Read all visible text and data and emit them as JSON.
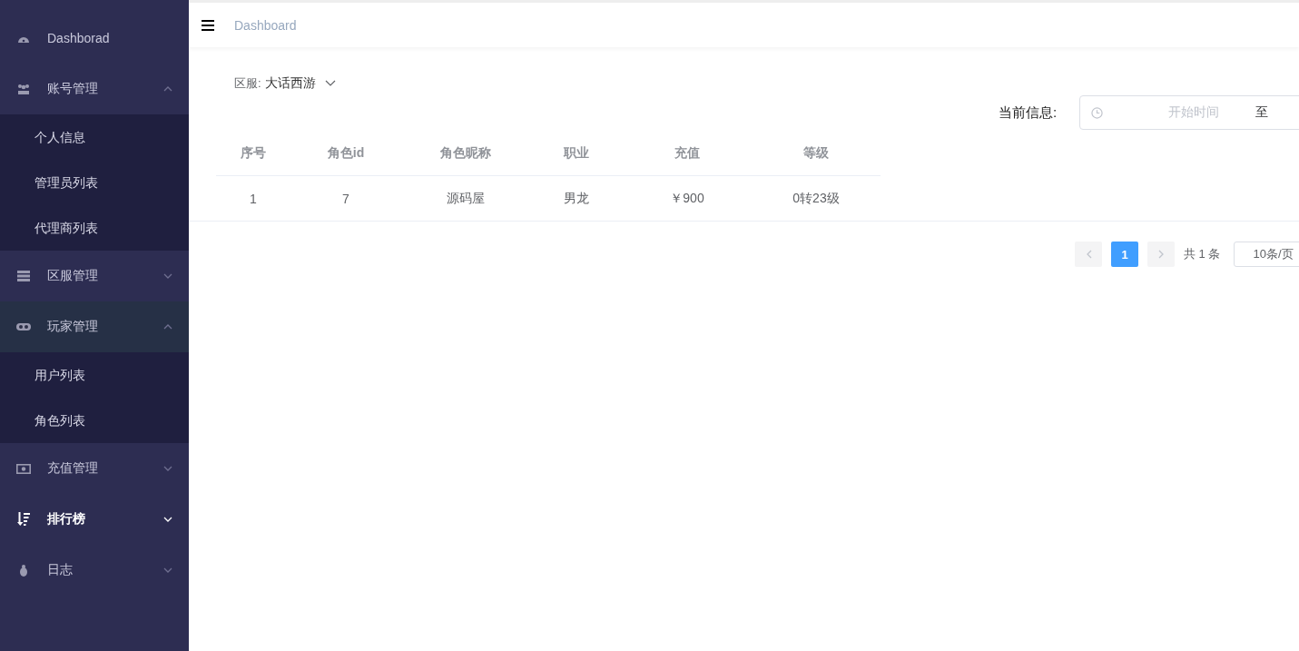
{
  "sidebar": {
    "items": [
      {
        "kind": "link",
        "label": "Dashborad",
        "selected": false
      },
      {
        "kind": "group",
        "label": "账号管理",
        "expanded": true,
        "selected": false,
        "children": [
          {
            "label": "个人信息"
          },
          {
            "label": "管理员列表"
          },
          {
            "label": "代理商列表"
          }
        ]
      },
      {
        "kind": "group",
        "label": "区服管理",
        "expanded": false,
        "selected": false
      },
      {
        "kind": "group",
        "label": "玩家管理",
        "expanded": true,
        "selected": true,
        "children": [
          {
            "label": "用户列表"
          },
          {
            "label": "角色列表"
          }
        ]
      },
      {
        "kind": "group",
        "label": "充值管理",
        "expanded": false,
        "selected": false
      },
      {
        "kind": "group",
        "label": "排行榜",
        "expanded": false,
        "selected": false,
        "hovered": true
      },
      {
        "kind": "group",
        "label": "日志",
        "expanded": false,
        "selected": false
      }
    ]
  },
  "header": {
    "breadcrumb": "Dashboard"
  },
  "filter": {
    "label": "区服:",
    "value": "大话西游"
  },
  "date_range": {
    "label": "当前信息:",
    "start_placeholder": "开始时间",
    "separator": "至"
  },
  "table": {
    "columns": [
      "序号",
      "角色id",
      "角色昵称",
      "职业",
      "充值",
      "等级"
    ],
    "rows": [
      [
        "1",
        "7",
        "源码屋",
        "男龙",
        "￥900",
        "0转23级"
      ]
    ]
  },
  "pagination": {
    "pages": [
      {
        "label": "1",
        "selected": true
      }
    ],
    "total": "共 1 条",
    "page_size": "10条/页"
  }
}
